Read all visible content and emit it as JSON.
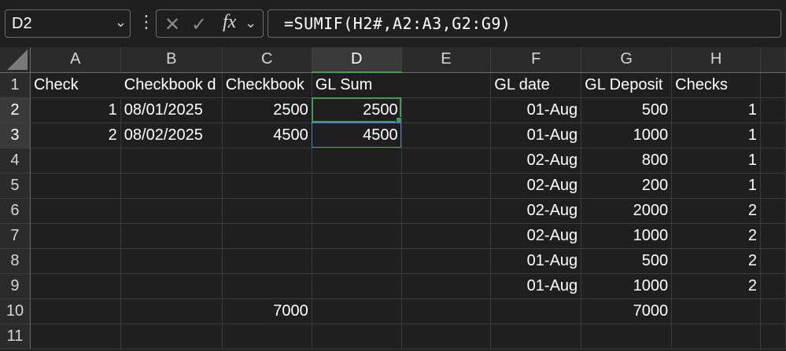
{
  "name_box": {
    "value": "D2"
  },
  "formula_bar": {
    "cancel_glyph": "✕",
    "enter_glyph": "✓",
    "fx_label": "fx",
    "formula": "=SUMIF(H2#,A2:A3,G2:G9)"
  },
  "colors": {
    "active_cell": "#3e9c56",
    "spill_border": "#5b7fc8",
    "background": "#1f1f1f"
  },
  "column_headers": [
    "A",
    "B",
    "C",
    "D",
    "E",
    "F",
    "G",
    "H"
  ],
  "rows": [
    {
      "n": "1",
      "cells": [
        "Check",
        "Checkbook d",
        "Checkbook",
        "GL Sum",
        "",
        "GL date",
        "GL Deposit",
        "Checks"
      ]
    },
    {
      "n": "2",
      "cells": [
        "1",
        "08/01/2025",
        "2500",
        "2500",
        "",
        "01-Aug",
        "500",
        "1"
      ]
    },
    {
      "n": "3",
      "cells": [
        "2",
        "08/02/2025",
        "4500",
        "4500",
        "",
        "01-Aug",
        "1000",
        "1"
      ]
    },
    {
      "n": "4",
      "cells": [
        "",
        "",
        "",
        "",
        "",
        "02-Aug",
        "800",
        "1"
      ]
    },
    {
      "n": "5",
      "cells": [
        "",
        "",
        "",
        "",
        "",
        "02-Aug",
        "200",
        "1"
      ]
    },
    {
      "n": "6",
      "cells": [
        "",
        "",
        "",
        "",
        "",
        "02-Aug",
        "2000",
        "2"
      ]
    },
    {
      "n": "7",
      "cells": [
        "",
        "",
        "",
        "",
        "",
        "02-Aug",
        "1000",
        "2"
      ]
    },
    {
      "n": "8",
      "cells": [
        "",
        "",
        "",
        "",
        "",
        "01-Aug",
        "500",
        "2"
      ]
    },
    {
      "n": "9",
      "cells": [
        "",
        "",
        "",
        "",
        "",
        "01-Aug",
        "1000",
        "2"
      ]
    },
    {
      "n": "10",
      "cells": [
        "",
        "",
        "7000",
        "",
        "",
        "",
        "7000",
        ""
      ]
    },
    {
      "n": "11",
      "cells": [
        "",
        "",
        "",
        "",
        "",
        "",
        "",
        ""
      ]
    }
  ]
}
